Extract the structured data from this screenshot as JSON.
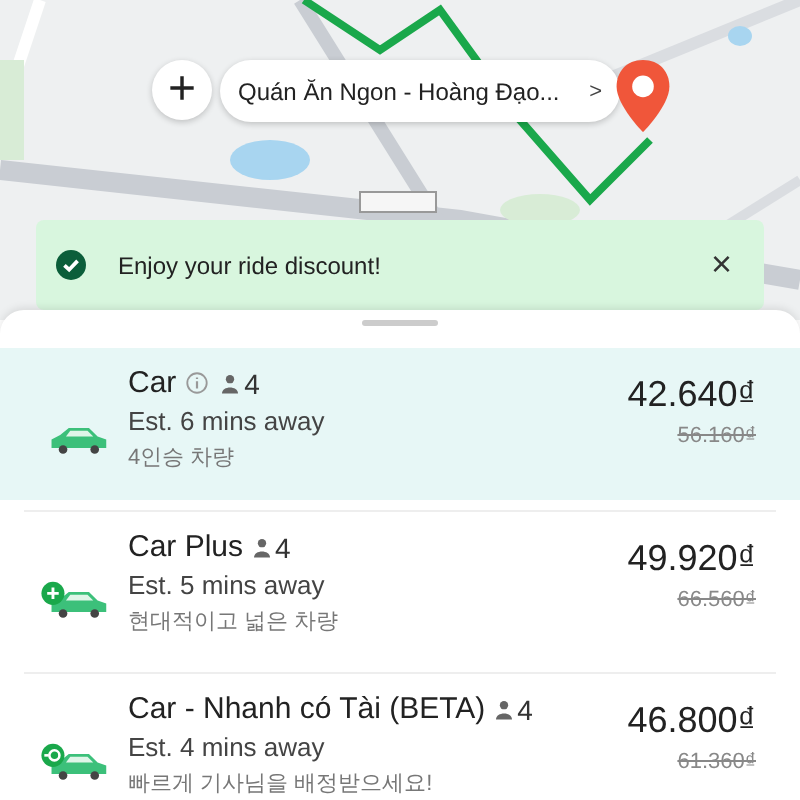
{
  "destination": {
    "label": "Quán Ăn Ngon - Hoàng Đạo...",
    "chevron": ">"
  },
  "add_stop": {
    "symbol": "+"
  },
  "toast": {
    "message": "Enjoy your ride discount!",
    "close": "×"
  },
  "rides": [
    {
      "name": "Car",
      "info": true,
      "kind": "plain",
      "seats": "4",
      "eta": "Est. 6 mins away",
      "note": "4인승 차량",
      "price": "42.640₫",
      "old_price": "56.160₫",
      "selected": true
    },
    {
      "name": "Car Plus",
      "info": false,
      "kind": "plus",
      "seats": "4",
      "eta": "Est. 5 mins away",
      "note": "현대적이고 넓은 차량",
      "price": "49.920₫",
      "old_price": "66.560₫",
      "selected": false
    },
    {
      "name": "Car - Nhanh có Tài (BETA)",
      "info": false,
      "kind": "fast",
      "seats": "4",
      "eta": "Est. 4 mins away",
      "note": "빠르게 기사님을 배정받으세요!",
      "price": "46.800₫",
      "old_price": "61.360₫",
      "selected": false
    }
  ]
}
